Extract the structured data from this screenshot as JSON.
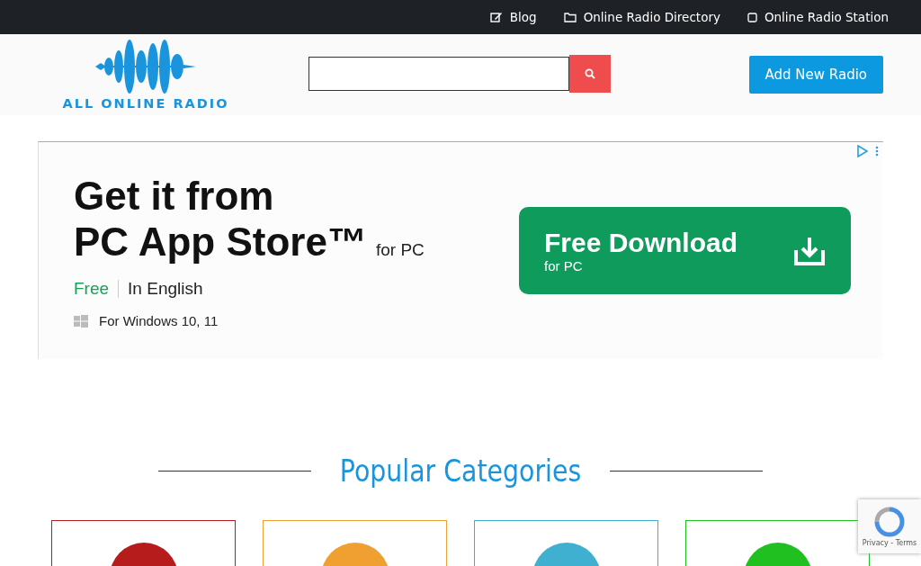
{
  "top_nav": [
    {
      "label": "Blog",
      "kind": "edit"
    },
    {
      "label": "Online Radio Directory",
      "kind": "folder"
    },
    {
      "label": "Online Radio Station",
      "kind": "square"
    }
  ],
  "logo": {
    "text": "ALL ONLINE RADIO"
  },
  "add_button": {
    "label": "Add New Radio",
    "kind": "primary"
  },
  "ad": {
    "headline_1": "Get it from",
    "headline_2": "PC App Store™",
    "headline_suffix": "for PC",
    "price": "Free",
    "language": "In English",
    "platform": "For Windows 10, 11",
    "cta": "Free Download",
    "cta_sub": "for PC"
  },
  "section_title": "Popular Categories",
  "categories": [
    {
      "color": "#b71c1c"
    },
    {
      "color": "#f0a030"
    },
    {
      "color": "#40b0d0"
    },
    {
      "color": "#20c020"
    }
  ],
  "recaptcha": {
    "links": "Privacy - Terms"
  }
}
